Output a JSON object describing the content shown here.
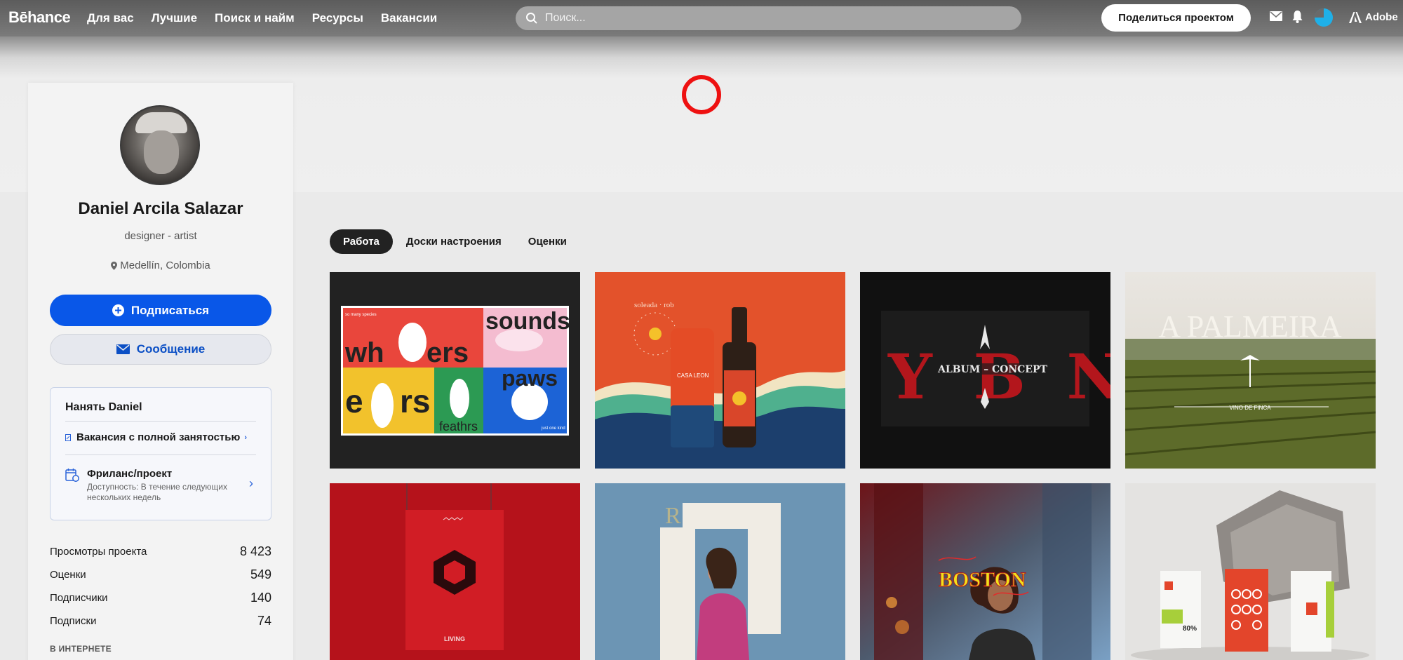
{
  "header": {
    "logo": "Bēhance",
    "nav": [
      "Для вас",
      "Лучшие",
      "Поиск и найм",
      "Ресурсы",
      "Вакансии"
    ],
    "search_placeholder": "Поиск...",
    "share_label": "Поделиться проектом",
    "adobe_label": "Adobe"
  },
  "profile": {
    "name": "Daniel Arcila Salazar",
    "role": "designer - artist",
    "location": "Medellín, Colombia",
    "follow_label": "Подписаться",
    "message_label": "Сообщение"
  },
  "hire": {
    "title": "Нанять Daniel",
    "fulltime_label": "Вакансия с полной занятостью",
    "freelance_title": "Фриланс/проект",
    "freelance_sub": "Доступность: В течение следующих нескольких недель"
  },
  "stats": [
    {
      "label": "Просмотры проекта",
      "value": "8 423"
    },
    {
      "label": "Оценки",
      "value": "549"
    },
    {
      "label": "Подписчики",
      "value": "140"
    },
    {
      "label": "Подписки",
      "value": "74"
    }
  ],
  "web_section_title": "В ИНТЕРНЕТЕ",
  "tabs": [
    "Работа",
    "Доски настроения",
    "Оценки"
  ],
  "projects": {
    "p1": {
      "tag": "so many species",
      "w1": "wh",
      "w1b": "ers",
      "w2": "sounds",
      "w3": "e",
      "w3b": "rs",
      "w4": "paws",
      "w5": "feath",
      "w5b": "rs",
      "small": "just one kind"
    },
    "p2": {
      "ring_text": "soleada · rob",
      "can_text": "CASA LEON"
    },
    "p3": {
      "big": "Y B N D",
      "sub": "ALBUM – CONCEPT"
    },
    "p4": {
      "title": "A PALMEIRA",
      "sub": "VINO DE FINCA"
    },
    "p5": {
      "brand": "LIVING"
    },
    "p6": {
      "letter": "R"
    },
    "p7": {
      "title": "BOSTON"
    },
    "p8": {
      "pct": "80%"
    }
  },
  "colors": {
    "accent": "#0957e8",
    "nav_bg": "#666666"
  }
}
